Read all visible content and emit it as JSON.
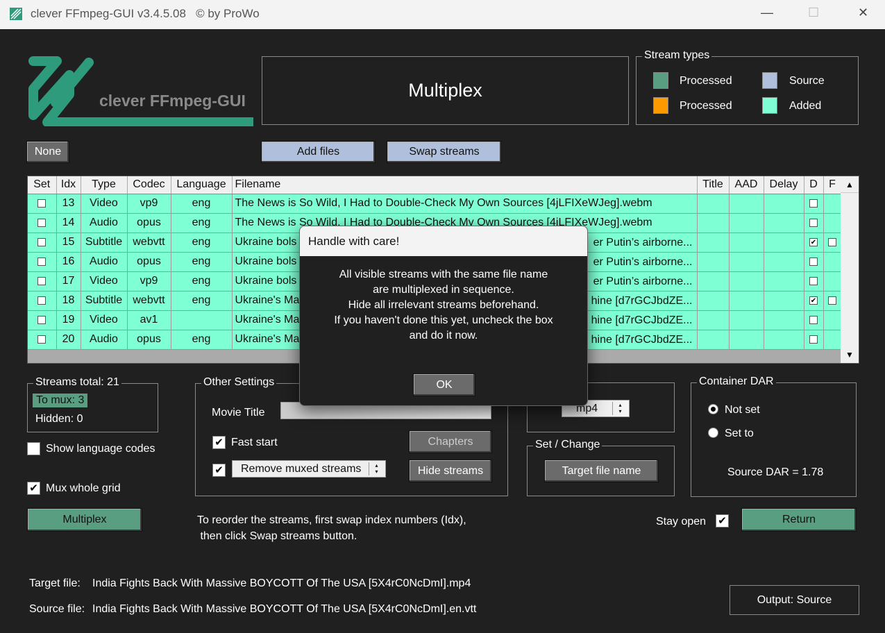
{
  "window": {
    "title": "clever FFmpeg-GUI v3.4.5.08   © by ProWo",
    "minimize": "—",
    "maximize": "☐",
    "close": "✕"
  },
  "logo": {
    "text": "clever FFmpeg-GUI"
  },
  "header": {
    "mode": "Multiplex"
  },
  "stream_types": {
    "legend": "Stream types",
    "items": [
      {
        "label": "Processed",
        "color": "#5a9e82"
      },
      {
        "label": "Source",
        "color": "#b0c0dc"
      },
      {
        "label": "Processed",
        "color": "#ff9900"
      },
      {
        "label": "Added",
        "color": "#7fffd4"
      }
    ]
  },
  "toolbar": {
    "none": "None",
    "add_files": "Add files",
    "swap_streams": "Swap streams"
  },
  "grid": {
    "columns": [
      "Set",
      "Idx",
      "Type",
      "Codec",
      "Language",
      "Filename",
      "Title",
      "AAD",
      "Delay",
      "D",
      "F"
    ],
    "rows": [
      {
        "set": false,
        "idx": "13",
        "type": "Video",
        "codec": "vp9",
        "language": "eng",
        "filename": "The News is So Wild, I Had to Double-Check My Own Sources [4jLFIXeWJeg].webm",
        "filename_tail": "",
        "d": false,
        "f": null
      },
      {
        "set": false,
        "idx": "14",
        "type": "Audio",
        "codec": "opus",
        "language": "eng",
        "filename": "The News is So Wild, I Had to Double-Check My Own Sources [4jLFIXeWJeg].webm",
        "filename_tail": "",
        "d": false,
        "f": null
      },
      {
        "set": false,
        "idx": "15",
        "type": "Subtitle",
        "codec": "webvtt",
        "language": "eng",
        "filename": "Ukraine bols",
        "filename_tail": "er Putin’s airborne...",
        "d": true,
        "f": false
      },
      {
        "set": false,
        "idx": "16",
        "type": "Audio",
        "codec": "opus",
        "language": "eng",
        "filename": "Ukraine bols",
        "filename_tail": "er Putin’s airborne...",
        "d": false,
        "f": null
      },
      {
        "set": false,
        "idx": "17",
        "type": "Video",
        "codec": "vp9",
        "language": "eng",
        "filename": "Ukraine bols",
        "filename_tail": "er Putin’s airborne...",
        "d": false,
        "f": null
      },
      {
        "set": false,
        "idx": "18",
        "type": "Subtitle",
        "codec": "webvtt",
        "language": "eng",
        "filename": "Ukraine's Ma",
        "filename_tail": "hine [d7rGCJbdZE...",
        "d": true,
        "f": false
      },
      {
        "set": false,
        "idx": "19",
        "type": "Video",
        "codec": "av1",
        "language": "",
        "filename": "Ukraine's Ma",
        "filename_tail": "hine [d7rGCJbdZE...",
        "d": false,
        "f": null
      },
      {
        "set": false,
        "idx": "20",
        "type": "Audio",
        "codec": "opus",
        "language": "eng",
        "filename": "Ukraine's Ma",
        "filename_tail": "hine [d7rGCJbdZE...",
        "d": false,
        "f": null
      }
    ]
  },
  "stats": {
    "total": "Streams total:  21",
    "to_mux": "To mux:  3",
    "hidden": "Hidden:  0"
  },
  "show_language_codes": {
    "label": "Show language codes",
    "checked": false
  },
  "mux_whole_grid": {
    "label": "Mux whole grid",
    "checked": true
  },
  "multiplex_button": "Multiplex",
  "other_settings": {
    "legend": "Other Settings",
    "movie_title_label": "Movie Title",
    "movie_title_value": "",
    "fast_start": "Fast start",
    "remove_option": "Remove muxed streams",
    "chapters": "Chapters",
    "hide_streams": "Hide streams"
  },
  "container": {
    "value": "mp4"
  },
  "set_change": {
    "legend": "Set / Change",
    "button": "Target file name"
  },
  "dar": {
    "legend": "Container DAR",
    "not_set": "Not set",
    "set_to": "Set to",
    "source": "Source DAR = 1.78"
  },
  "hint": {
    "line1": "To reorder the streams, first swap index numbers (Idx),",
    "line2": " then click Swap streams button."
  },
  "stay_open": "Stay open",
  "return_button": "Return",
  "target_file": {
    "label": "Target file:",
    "value": "India Fights Back With Massive BOYCOTT Of The USA [5X4rC0NcDmI].mp4"
  },
  "source_file": {
    "label": "Source file:",
    "value": "India Fights Back With Massive BOYCOTT Of The USA [5X4rC0NcDmI].en.vtt"
  },
  "output_button": "Output: Source",
  "dialog": {
    "title": "Handle with care!",
    "lines": [
      "All visible streams with the same file name",
      "are multiplexed in sequence.",
      "Hide all irrelevant streams beforehand.",
      "If you haven't done this yet, uncheck the box",
      "and do it now."
    ],
    "ok": "OK"
  }
}
